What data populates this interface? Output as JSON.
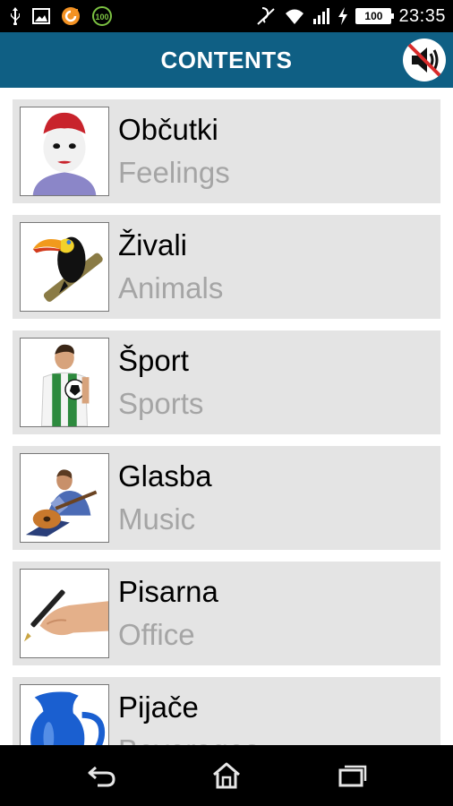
{
  "status_bar": {
    "time": "23:35",
    "battery": "100",
    "left_icons": [
      "usb-icon",
      "image-icon",
      "orange-app-icon",
      "battery-100-badge-icon"
    ],
    "right_icons": [
      "accessibility-icon",
      "wifi-icon",
      "signal-icon",
      "charging-icon",
      "battery-icon"
    ],
    "badge_text": "100"
  },
  "app_bar": {
    "title": "CONTENTS",
    "sound_button": "sound-muted-icon",
    "bar_color": "#0f5f84"
  },
  "categories": [
    {
      "native": "Občutki",
      "english": "Feelings",
      "image": "mime-face"
    },
    {
      "native": "Živali",
      "english": "Animals",
      "image": "toucan"
    },
    {
      "native": "Šport",
      "english": "Sports",
      "image": "soccer-player"
    },
    {
      "native": "Glasba",
      "english": "Music",
      "image": "guitar-player"
    },
    {
      "native": "Pisarna",
      "english": "Office",
      "image": "hand-with-pen"
    },
    {
      "native": "Pijače",
      "english": "Beverages",
      "image": "blue-jug"
    }
  ],
  "nav_bar": {
    "buttons": [
      "back-icon",
      "home-icon",
      "recents-icon"
    ]
  }
}
